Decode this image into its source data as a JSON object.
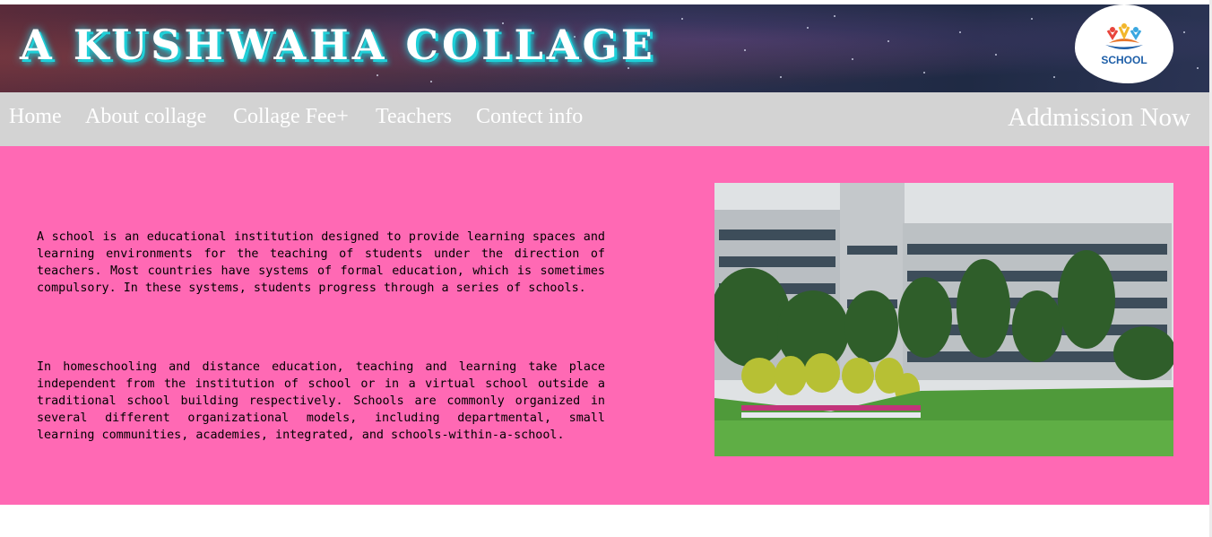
{
  "header": {
    "title": "A KUSHWAHA COLLAGE",
    "logo_text": "SCHOOL",
    "logo_icon": "school-children-logo-icon"
  },
  "nav": {
    "items": [
      {
        "label": "Home"
      },
      {
        "label": "About collage"
      },
      {
        "label": "Collage Fee+"
      },
      {
        "label": "Teachers"
      },
      {
        "label": "Contect info"
      }
    ],
    "cta_label": "Addmission Now"
  },
  "main": {
    "paragraphs": [
      "A school is an educational institution designed to provide learning spaces and learning environments for the teaching of students under the direction of teachers. Most countries have systems of formal education, which is sometimes compulsory. In these systems, students progress through a series of schools.",
      "In homeschooling and distance education, teaching and learning take place independent from the institution of school or in a virtual school outside a traditional school building respectively. Schools are commonly organized in several different organizational models, including departmental, small learning communities, academies, integrated, and schools-within-a-school."
    ],
    "image_subject": "college-building-photo"
  },
  "colors": {
    "nav_bg": "#d3d3d3",
    "main_bg": "#ff69b4",
    "title_glow": "#1fd0d8"
  }
}
